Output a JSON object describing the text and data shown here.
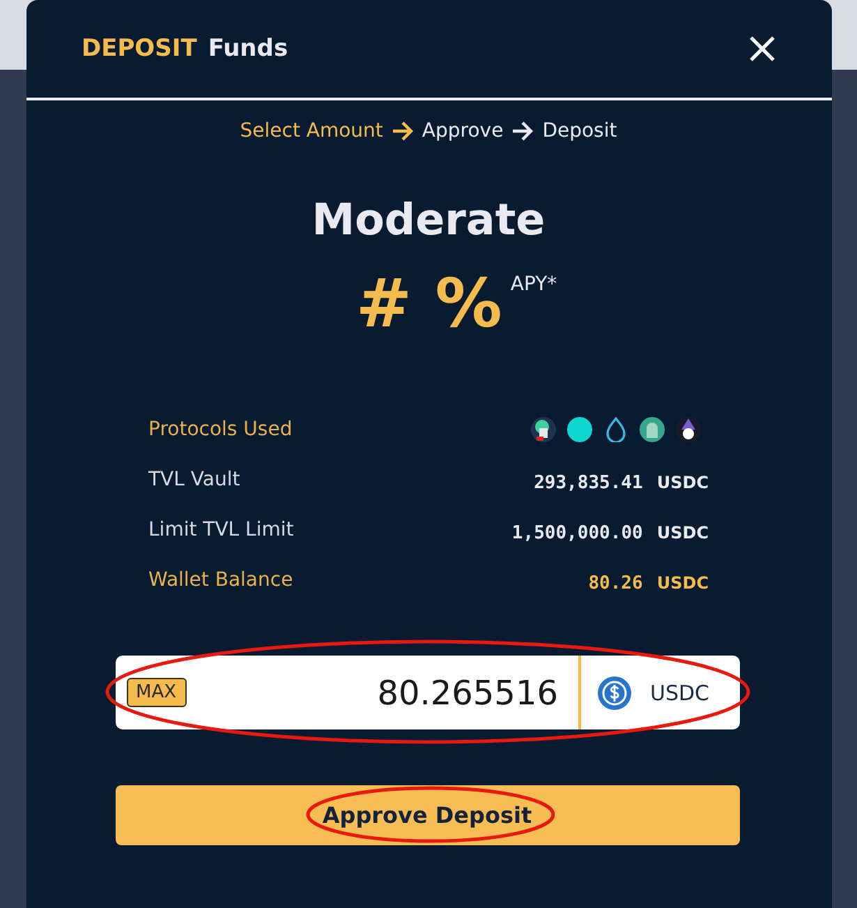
{
  "modal": {
    "title_accent": "DEPOSIT",
    "title": "Funds"
  },
  "steps": [
    {
      "label": "Select Amount",
      "selected": true
    },
    {
      "label": "Approve",
      "selected": false
    },
    {
      "label": "Deposit",
      "selected": false
    }
  ],
  "strategy": {
    "name": "Moderate",
    "apy": "# %",
    "apy_label": "APY*"
  },
  "protocols": {
    "label": "Protocols Used",
    "icons": [
      {
        "kind": "skull"
      },
      {
        "kind": "dot"
      },
      {
        "kind": "drop"
      },
      {
        "kind": "ghost"
      },
      {
        "kind": "wizard"
      }
    ]
  },
  "stats": [
    {
      "label": "TVL Vault",
      "value": "293,835.41",
      "unit": "USDC",
      "highlight": false
    },
    {
      "label": "Limit TVL Limit",
      "value": "1,500,000.00",
      "unit": "USDC",
      "highlight": false
    },
    {
      "label": "Wallet Balance",
      "value": "80.26",
      "unit": "USDC",
      "highlight": true
    }
  ],
  "amount": {
    "max": "MAX",
    "value": "80.265516",
    "currency": "USDC",
    "annotated": true
  },
  "submit": {
    "label": "Approve Deposit",
    "annotated": true
  }
}
